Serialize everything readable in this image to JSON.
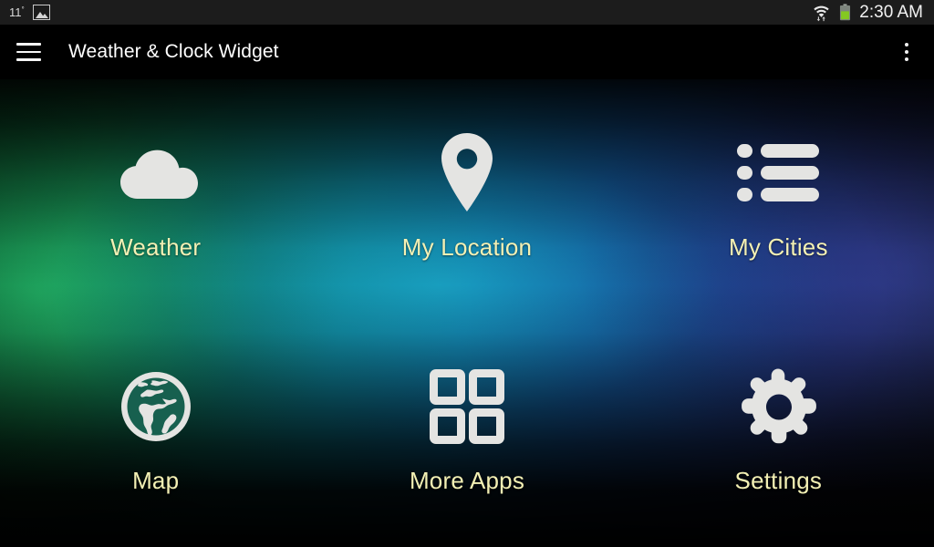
{
  "status_bar": {
    "temperature": "11",
    "degree_symbol": "°",
    "photo_icon": "image-icon",
    "wifi_icon": "wifi-transfer-icon",
    "battery_icon": "battery-icon",
    "time": "2:30 AM"
  },
  "action_bar": {
    "menu_icon": "hamburger-menu-icon",
    "title": "Weather & Clock Widget",
    "overflow_icon": "overflow-menu-icon"
  },
  "theme": {
    "label_color": "#f3f0b4",
    "icon_color": "#e4e4e2",
    "status_bar_bg": "#1c1c1c",
    "action_bar_bg": "#000000",
    "accent_green": "#0f7a3e",
    "accent_cyan": "#14a7c4",
    "accent_indigo": "#23306e"
  },
  "grid": {
    "tiles": [
      {
        "id": "weather",
        "label": "Weather",
        "icon": "cloud-icon"
      },
      {
        "id": "my-location",
        "label": "My Location",
        "icon": "map-pin-icon"
      },
      {
        "id": "my-cities",
        "label": "My Cities",
        "icon": "list-icon"
      },
      {
        "id": "map",
        "label": "Map",
        "icon": "globe-icon"
      },
      {
        "id": "more-apps",
        "label": "More Apps",
        "icon": "grid-apps-icon"
      },
      {
        "id": "settings",
        "label": "Settings",
        "icon": "gear-icon"
      }
    ]
  }
}
